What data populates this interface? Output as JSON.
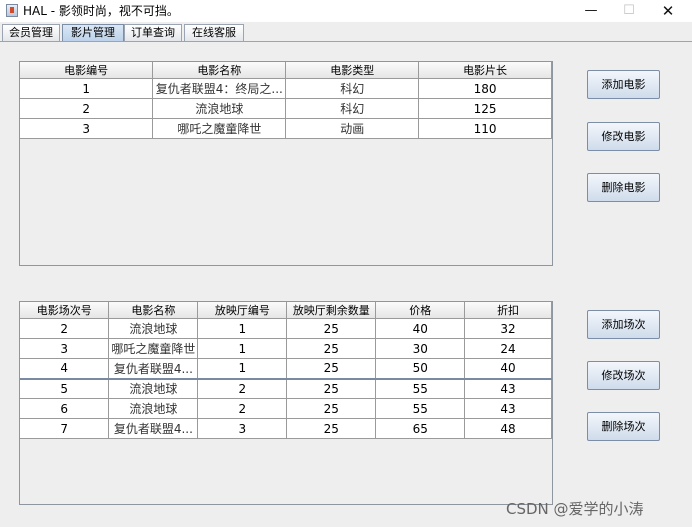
{
  "window": {
    "title": "HAL - 影领时尚，视不可挡。",
    "minimize_glyph": "—",
    "maximize_glyph": "☐",
    "close_glyph": "✕",
    "app_icon": "java-app-icon"
  },
  "tabs": [
    {
      "label": "会员管理",
      "active": false
    },
    {
      "label": "影片管理",
      "active": true
    },
    {
      "label": "订单查询",
      "active": false
    },
    {
      "label": "在线客服",
      "active": false
    }
  ],
  "movie_table": {
    "headers": [
      "电影编号",
      "电影名称",
      "电影类型",
      "电影片长"
    ],
    "rows": [
      [
        "1",
        "复仇者联盟4：终局之...",
        "科幻",
        "180"
      ],
      [
        "2",
        "流浪地球",
        "科幻",
        "125"
      ],
      [
        "3",
        "哪吒之魔童降世",
        "动画",
        "110"
      ]
    ]
  },
  "movie_buttons": {
    "add": "添加电影",
    "edit": "修改电影",
    "delete": "删除电影"
  },
  "session_table": {
    "headers": [
      "电影场次号",
      "电影名称",
      "放映厅编号",
      "放映厅剩余数量",
      "价格",
      "折扣"
    ],
    "rows": [
      [
        "2",
        "流浪地球",
        "1",
        "25",
        "40",
        "32"
      ],
      [
        "3",
        "哪吒之魔童降世",
        "1",
        "25",
        "30",
        "24"
      ],
      [
        "4",
        "复仇者联盟4...",
        "1",
        "25",
        "50",
        "40"
      ],
      [
        "5",
        "流浪地球",
        "2",
        "25",
        "55",
        "43"
      ],
      [
        "6",
        "流浪地球",
        "2",
        "25",
        "55",
        "43"
      ],
      [
        "7",
        "复仇者联盟4...",
        "3",
        "25",
        "65",
        "48"
      ]
    ]
  },
  "session_buttons": {
    "add": "添加场次",
    "edit": "修改场次",
    "delete": "删除场次"
  },
  "watermark": "CSDN @爱学的小涛"
}
